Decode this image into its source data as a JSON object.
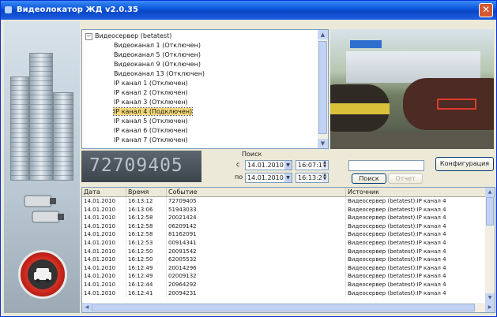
{
  "window": {
    "title": "Видеолокатор ЖД v2.0.35",
    "close_label": "✕"
  },
  "tree": {
    "root": "Видеосервер (betatest)",
    "items": [
      "Видеоканал 1 (Отключен)",
      "Видеоканал 5 (Отключен)",
      "Видеоканал 9 (Отключен)",
      "Видеоканал 13 (Отключен)",
      "IP канал 1 (Отключен)",
      "IP канал 2 (Отключен)",
      "IP канал 3 (Отключен)",
      "IP канал 4 (Подключен)",
      "IP канал 5 (Отключен)",
      "IP канал 6 (Отключен)",
      "IP канал 7 (Отключен)"
    ],
    "selected_index": 7
  },
  "recognized_plate": "72709405",
  "search": {
    "title": "Поиск",
    "from_label": "с",
    "to_label": "по",
    "from_date": "14.01.2010",
    "from_time": "16:07:18",
    "to_date": "14.01.2010",
    "to_time": "16:13:28",
    "query_value": "",
    "search_button": "Поиск",
    "report_button": "Отчет",
    "config_button": "Конфигурация"
  },
  "table": {
    "columns": [
      "Дата",
      "Время",
      "Событие",
      "Источник"
    ],
    "rows": [
      [
        "14.01.2010",
        "16:13:12",
        "72709405",
        "Видеосервер (betatest):IP канал 4"
      ],
      [
        "14.01.2010",
        "16:13:06",
        "51943033",
        "Видеосервер (betatest):IP канал 4"
      ],
      [
        "14.01.2010",
        "16:12:58",
        "20021424",
        "Видеосервер (betatest):IP канал 4"
      ],
      [
        "14.01.2010",
        "16:12:58",
        "06209142",
        "Видеосервер (betatest):IP канал 4"
      ],
      [
        "14.01.2010",
        "16:12:58",
        "81162091",
        "Видеосервер (betatest):IP канал 4"
      ],
      [
        "14.01.2010",
        "16:12:53",
        "00914341",
        "Видеосервер (betatest):IP канал 4"
      ],
      [
        "14.01.2010",
        "16:12:50",
        "20091542",
        "Видеосервер (betatest):IP канал 4"
      ],
      [
        "14.01.2010",
        "16:12:50",
        "62005532",
        "Видеосервер (betatest):IP канал 4"
      ],
      [
        "14.01.2010",
        "16:12:49",
        "20014296",
        "Видеосервер (betatest):IP канал 4"
      ],
      [
        "14.01.2010",
        "16:12:49",
        "02009132",
        "Видеосервер (betatest):IP канал 4"
      ],
      [
        "14.01.2010",
        "16:12:44",
        "20964292",
        "Видеосервер (betatest):IP канал 4"
      ],
      [
        "14.01.2010",
        "16:12:41",
        "20094231",
        "Видеосервер (betatest):IP канал 4"
      ]
    ]
  },
  "colors": {
    "titlebar": "#0a52d8",
    "plate_frame": "#e03a2a",
    "selected_item": "#f5d87a"
  }
}
